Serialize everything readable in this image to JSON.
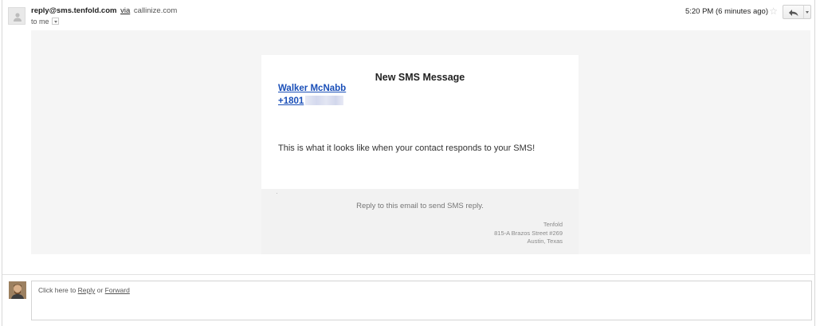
{
  "header": {
    "from": "reply@sms.tenfold.com",
    "via_label": "via",
    "via_domain": "callinize.com",
    "to_label": "to me",
    "time": "5:20 PM (6 minutes ago)"
  },
  "card": {
    "title": "New SMS Message",
    "contact_name": "Walker McNabb",
    "contact_phone_visible": "+1801",
    "message": "This is what it looks like when your contact responds to your SMS!"
  },
  "footer": {
    "reply_hint": "Reply to this email to send SMS reply.",
    "company": "Tenfold",
    "street": "815-A Brazos Street #269",
    "city": "Austin, Texas"
  },
  "composer": {
    "prefix": "Click here to",
    "reply": "Reply",
    "or": "or",
    "forward": "Forward"
  },
  "colors": {
    "link_blue": "#1a4fb8",
    "message_bg": "#f5f5f5"
  },
  "icons": [
    "person-avatar-icon",
    "dropdown-caret-icon",
    "star-icon",
    "reply-arrow-icon"
  ]
}
